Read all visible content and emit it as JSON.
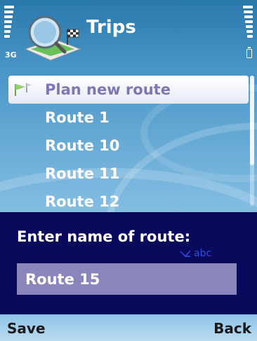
{
  "status": {
    "network": "3G"
  },
  "app": {
    "title": "Trips"
  },
  "list": {
    "items": [
      {
        "label": "Plan new route",
        "highlighted": true
      },
      {
        "label": "Route 1"
      },
      {
        "label": "Route 10"
      },
      {
        "label": "Route 11"
      },
      {
        "label": "Route 12"
      }
    ]
  },
  "dialog": {
    "prompt": "Enter name of route:",
    "input_mode": "abc",
    "value": "Route 15"
  },
  "softkeys": {
    "left": "Save",
    "right": "Back"
  },
  "colors": {
    "dialog_bg": "#0a0a5c",
    "field_bg": "#8a86bd",
    "highlight_text": "#7c78b6"
  }
}
